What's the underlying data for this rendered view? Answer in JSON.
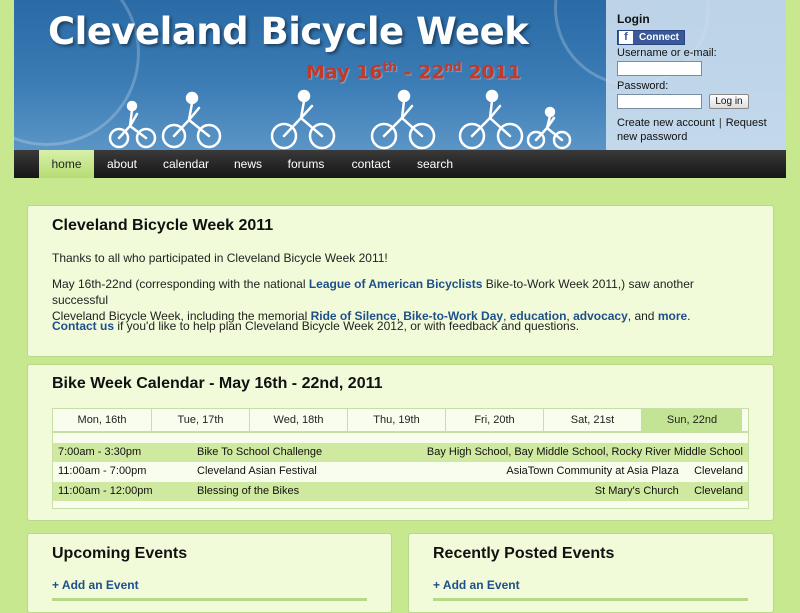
{
  "header": {
    "title": "Cleveland Bicycle Week",
    "dates": {
      "part1": "May 16",
      "sup1": "th",
      "part2": " - 22",
      "sup2": "nd",
      "part3": " 2011"
    }
  },
  "login": {
    "title": "Login",
    "connect_label": "Connect",
    "username_label": "Username or e-mail:",
    "password_label": "Password:",
    "login_button": "Log in",
    "create_account": "Create new account",
    "request_password": "Request new password"
  },
  "nav": {
    "items": [
      "home",
      "about",
      "calendar",
      "news",
      "forums",
      "contact",
      "search"
    ],
    "active": "home"
  },
  "intro": {
    "title": "Cleveland Bicycle Week 2011",
    "thanks": "Thanks to all who participated in Cleveland Bicycle Week 2011!",
    "p2_a": "May 16th-22nd (corresponding with the national ",
    "p2_link1": "League of American Bicyclists",
    "p2_b": " Bike-to-Work Week 2011,) saw another successful",
    "p2_c": "Cleveland Bicycle Week, including the memorial ",
    "p2_link2": "Ride of Silence",
    "p2_d": ", ",
    "p2_link3": "Bike-to-Work Day",
    "p2_e": ", ",
    "p2_link4": "education",
    "p2_f": ", ",
    "p2_link5": "advocacy",
    "p2_g": ", and ",
    "p2_link6": "more",
    "p2_h": ".",
    "p3_link": "Contact us",
    "p3_text": " if you'd like to help plan Cleveland Bicycle Week 2012, or with feedback and questions."
  },
  "calendar": {
    "title": "Bike Week Calendar - May 16th - 22nd, 2011",
    "days": [
      "Mon, 16th",
      "Tue, 17th",
      "Wed, 18th",
      "Thu, 19th",
      "Fri, 20th",
      "Sat, 21st",
      "Sun, 22nd"
    ],
    "active_day": "Sun, 22nd",
    "events": [
      {
        "time": "7:00am - 3:30pm",
        "name": "Bike To School Challenge",
        "place": "Bay High School, Bay Middle School, Rocky River Middle School"
      },
      {
        "time": "11:00am - 7:00pm",
        "name": "Cleveland Asian Festival",
        "place": "AsiaTown Community at Asia Plaza     Cleveland"
      },
      {
        "time": "11:00am - 12:00pm",
        "name": "Blessing of the Bikes",
        "place": "St Mary's Church     Cleveland"
      }
    ]
  },
  "upcoming": {
    "title": "Upcoming Events",
    "add_link": "+ Add an Event"
  },
  "recent": {
    "title": "Recently Posted Events",
    "add_link": "+ Add an Event"
  },
  "colors": {
    "header_blue": "#2a6aa5",
    "page_green": "#c8e890",
    "panel_bg": "#f1fbd9",
    "date_red": "#c0392b",
    "link_blue": "#1e4f8a"
  }
}
